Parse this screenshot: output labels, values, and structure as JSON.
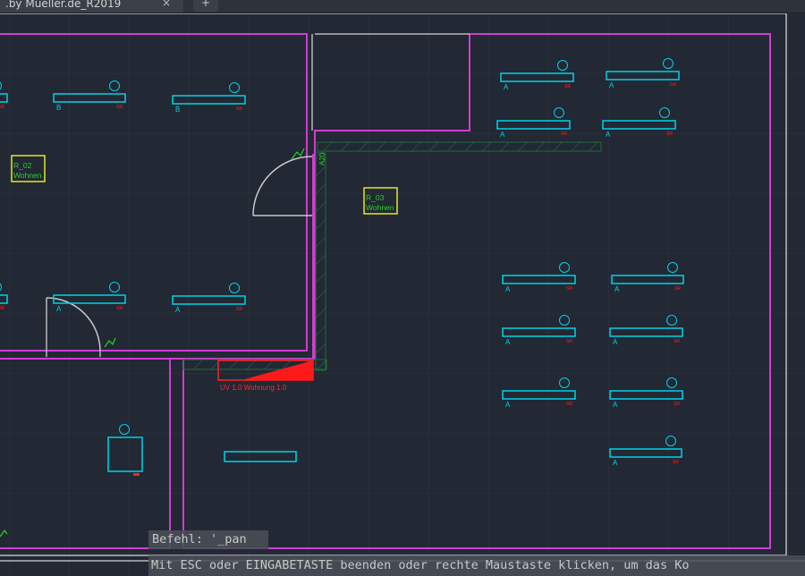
{
  "window": {
    "tab_title": ".by Mueller.de_R2019",
    "tab_close": "×",
    "new_tab": "+"
  },
  "drawing": {
    "rooms": [
      {
        "id": "R_02",
        "name": "Wohnen"
      },
      {
        "id": "R_03",
        "name": "Wohnen"
      }
    ],
    "distribution_board": "UV 1.0 Wohnung 1.0",
    "fixture_tags": {
      "a": "A",
      "b": "B"
    },
    "circuit_marker": "SR",
    "switch_tag": "A20"
  },
  "command_line": {
    "prompt": "Befehl: '_pan",
    "message": "Mit ESC oder EINGABETASTE beenden oder rechte Maustaste klicken, um das Ko"
  },
  "colors": {
    "background": "#222834",
    "grid": "#2d3441",
    "walls": "#d23cd2",
    "fixtures": "#00d2e6",
    "markers": "#ff2222",
    "labels": "#20d820",
    "room_tag": "#e6e62a",
    "hatch": "#1e6e3a"
  }
}
